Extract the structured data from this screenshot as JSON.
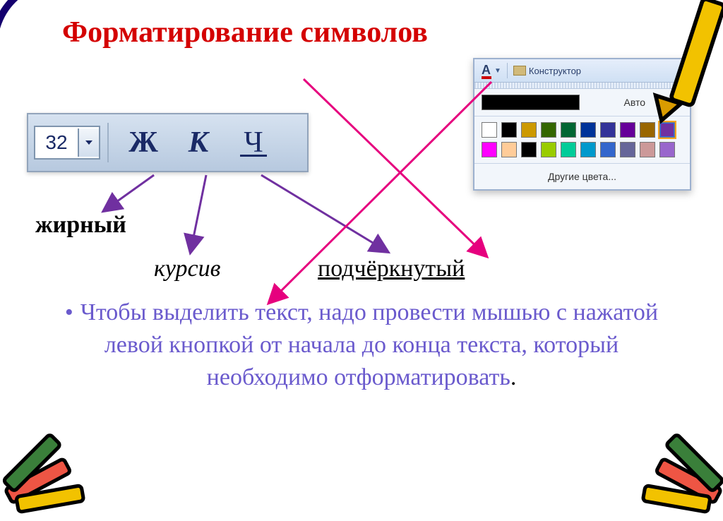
{
  "title": "Форматирование символов",
  "toolbar": {
    "font_size": "32",
    "bold_letter": "Ж",
    "italic_letter": "К",
    "underline_letter": "Ч"
  },
  "labels": {
    "bold": "жирный",
    "italic": "курсив",
    "underline": "подчёркнутый"
  },
  "body": {
    "text": "Чтобы выделить текст, надо провести мышью с нажатой левой кнопкой от начала до конца текста, который необходимо отформатировать",
    "stop": "."
  },
  "picker": {
    "constructor_label": "Конструктор",
    "auto_label": "Авто",
    "more_label": "Другие цвета...",
    "auto_swatch": "#000000",
    "rows": [
      [
        "#ffffff",
        "#000000",
        "#cc9900",
        "#336600",
        "#006633",
        "#003399",
        "#333399",
        "#660099",
        "#996600",
        "#7030a0"
      ],
      [
        "#ff00ff",
        "#ffcc99",
        "#000000",
        "#99cc00",
        "#00cc99",
        "#0099cc",
        "#3366cc",
        "#666699",
        "#cc9999",
        "#9966cc"
      ]
    ],
    "selected": [
      0,
      9
    ]
  },
  "colors": {
    "title": "#d40000",
    "body_text": "#6a5acd",
    "arrows_purple": "#7030a0",
    "arrows_magenta": "#e6007e"
  }
}
